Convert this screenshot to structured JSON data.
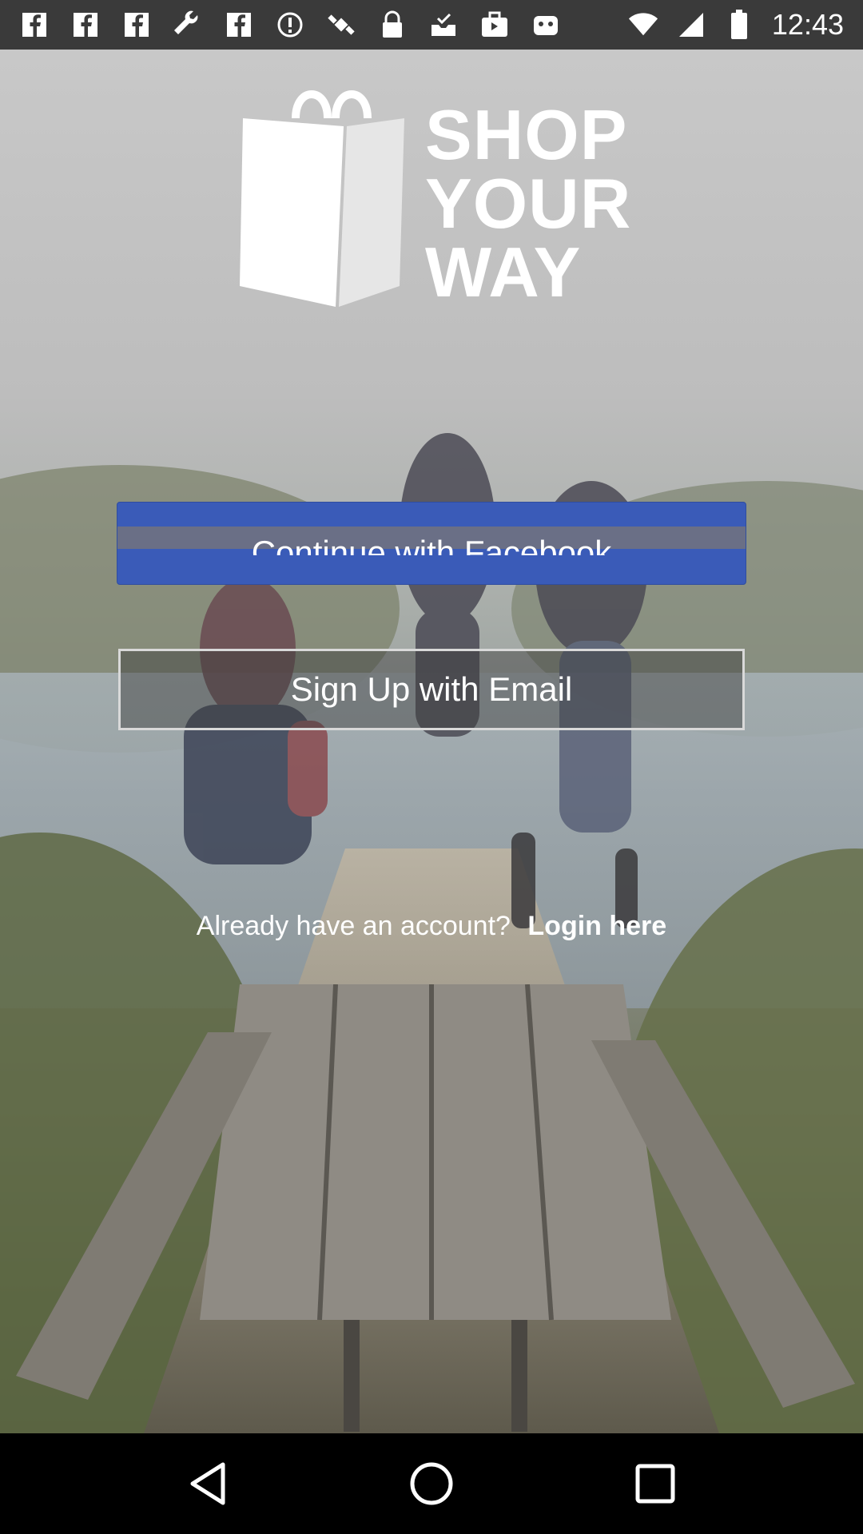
{
  "status_bar": {
    "time": "12:43",
    "icons": [
      "facebook-icon",
      "facebook-icon",
      "facebook-icon",
      "wrench-icon",
      "facebook-icon",
      "alert-icon",
      "satellite-icon",
      "lock-icon",
      "inbox-check-icon",
      "briefcase-icon",
      "android-icon"
    ],
    "right_icons": [
      "wifi-icon",
      "signal-icon",
      "battery-icon"
    ]
  },
  "logo": {
    "line1": "SHOP",
    "line2": "YOUR",
    "line3": "WAY"
  },
  "buttons": {
    "facebook_label": "Continue with Facebook",
    "email_label": "Sign Up with Email"
  },
  "login": {
    "prompt": "Already have an account?",
    "link": "Login here"
  },
  "colors": {
    "facebook_blue": "#3a5bb8",
    "status_bar": "#3a3a3a",
    "nav_bar": "#000000"
  }
}
